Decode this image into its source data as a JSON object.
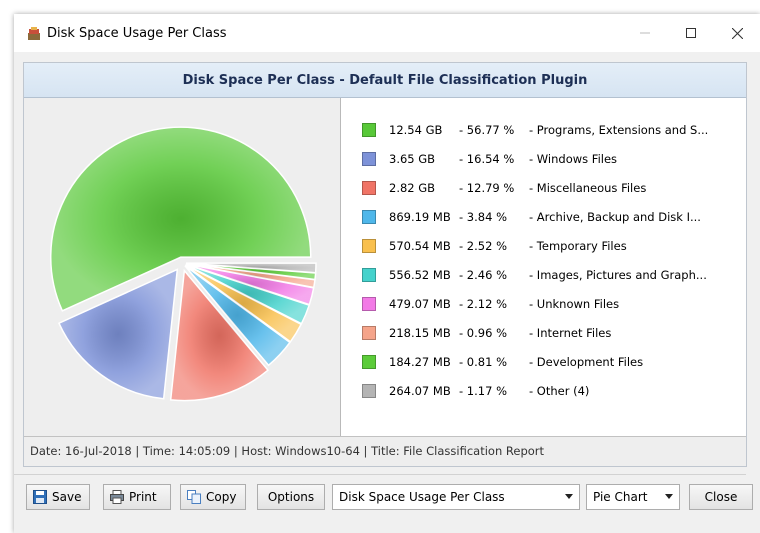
{
  "window": {
    "title": "Disk Space Usage Per Class"
  },
  "report": {
    "title": "Disk Space Per Class - Default File Classification Plugin",
    "footer": "Date: 16-Jul-2018 | Time: 14:05:09 | Host: Windows10-64 | Title: File Classification Report"
  },
  "chart_data": {
    "type": "pie",
    "title": "Disk Space Per Class - Default File Classification Plugin",
    "slices": [
      {
        "label": "Programs, Extensions and S...",
        "size": "12.54 GB",
        "percent": 56.77,
        "percent_text": "- 56.77 %",
        "color": "#58c838"
      },
      {
        "label": "Windows Files",
        "size": "3.65 GB",
        "percent": 16.54,
        "percent_text": "- 16.54 %",
        "color": "#7d92d8"
      },
      {
        "label": "Miscellaneous Files",
        "size": "2.82 GB",
        "percent": 12.79,
        "percent_text": "- 12.79 %",
        "color": "#f07466"
      },
      {
        "label": "Archive, Backup and Disk I...",
        "size": "869.19 MB",
        "percent": 3.84,
        "percent_text": "- 3.84 %",
        "color": "#4fb7ea"
      },
      {
        "label": "Temporary Files",
        "size": "570.54 MB",
        "percent": 2.52,
        "percent_text": "- 2.52 %",
        "color": "#f9c04e"
      },
      {
        "label": "Images, Pictures and Graph...",
        "size": "556.52 MB",
        "percent": 2.46,
        "percent_text": "- 2.46 %",
        "color": "#45d2cc"
      },
      {
        "label": "Unknown Files",
        "size": "479.07 MB",
        "percent": 2.12,
        "percent_text": "- 2.12 %",
        "color": "#f27ae6"
      },
      {
        "label": "Internet Files",
        "size": "218.15 MB",
        "percent": 0.96,
        "percent_text": "- 0.96 %",
        "color": "#f5a48a"
      },
      {
        "label": "Development Files",
        "size": "184.27 MB",
        "percent": 0.81,
        "percent_text": "- 0.81 %",
        "color": "#5ccc3a"
      },
      {
        "label": "Other (4)",
        "size": "264.07 MB",
        "percent": 1.17,
        "percent_text": "- 1.17 %",
        "color": "#b4b4b4"
      }
    ]
  },
  "toolbar": {
    "save": "Save",
    "print": "Print",
    "copy": "Copy",
    "options": "Options",
    "report_select": "Disk Space Usage Per Class",
    "chart_type_select": "Pie Chart",
    "close": "Close"
  },
  "icons": {
    "app": "app-icon",
    "save": "floppy-disk-icon",
    "print": "printer-icon",
    "copy": "copy-icon"
  }
}
